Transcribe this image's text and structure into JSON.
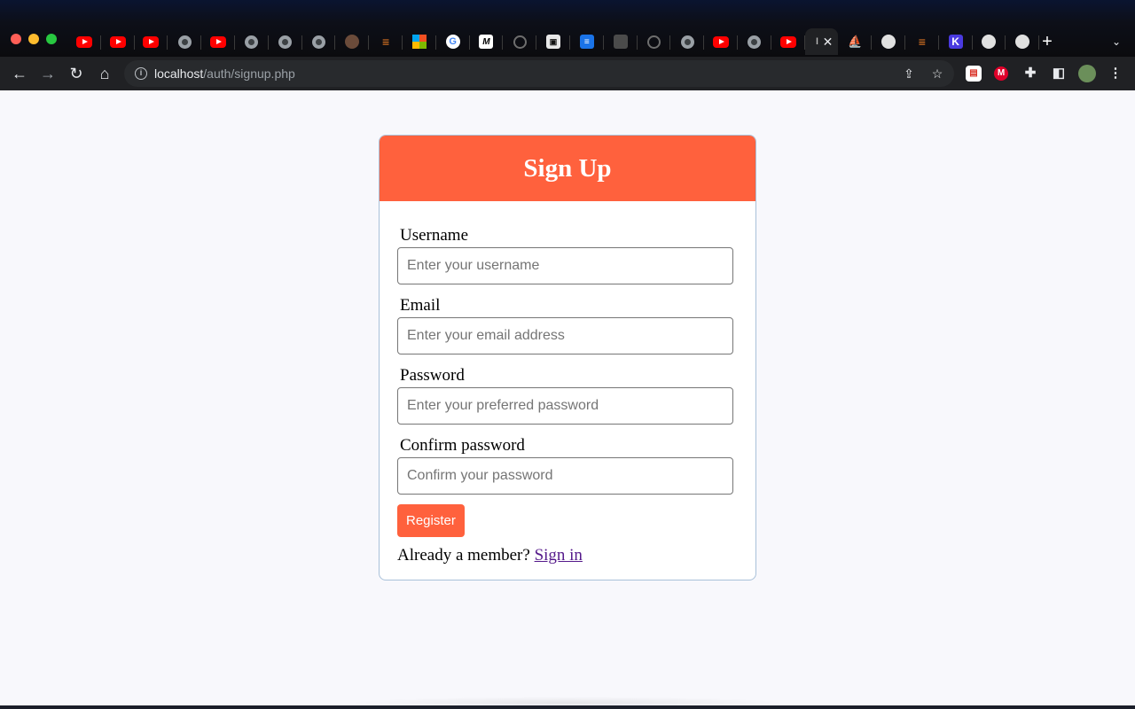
{
  "browser": {
    "tabs": [
      {
        "icon": "youtube-icon",
        "glyph": ""
      },
      {
        "icon": "youtube-icon",
        "glyph": ""
      },
      {
        "icon": "youtube-icon",
        "glyph": ""
      },
      {
        "icon": "globe-icon",
        "glyph": ""
      },
      {
        "icon": "youtube-icon",
        "glyph": ""
      },
      {
        "icon": "globe-icon",
        "glyph": ""
      },
      {
        "icon": "globe-icon",
        "glyph": ""
      },
      {
        "icon": "globe-icon",
        "glyph": ""
      },
      {
        "icon": "mascot-icon",
        "glyph": ""
      },
      {
        "icon": "stackoverflow-icon",
        "glyph": "≡"
      },
      {
        "icon": "microsoft-icon",
        "glyph": ""
      },
      {
        "icon": "google-icon",
        "glyph": "G"
      },
      {
        "icon": "medium-icon",
        "glyph": "M"
      },
      {
        "icon": "github-icon",
        "glyph": ""
      },
      {
        "icon": "terminal-icon",
        "glyph": "▣"
      },
      {
        "icon": "document-icon",
        "glyph": "≡"
      },
      {
        "icon": "image-icon",
        "glyph": ""
      },
      {
        "icon": "github-icon",
        "glyph": ""
      },
      {
        "icon": "globe-icon",
        "glyph": ""
      },
      {
        "icon": "youtube-icon",
        "glyph": ""
      },
      {
        "icon": "globe-icon",
        "glyph": ""
      },
      {
        "icon": "youtube-icon",
        "glyph": ""
      },
      {
        "icon": "partial-icon",
        "glyph": "l"
      },
      {
        "icon": "sailboat-icon",
        "glyph": "⛵"
      },
      {
        "icon": "elephant-icon",
        "glyph": ""
      },
      {
        "icon": "stackoverflow-icon",
        "glyph": "≡"
      },
      {
        "icon": "k-icon",
        "glyph": "K"
      },
      {
        "icon": "elephant-icon",
        "glyph": ""
      },
      {
        "icon": "elephant-icon",
        "glyph": ""
      }
    ],
    "active_tab_index": 22,
    "close_glyph": "✕",
    "new_tab_glyph": "+",
    "tab_search_glyph": "⌄",
    "nav": {
      "back": "←",
      "forward": "→",
      "reload": "↻",
      "home": "⌂"
    },
    "url_host": "localhost",
    "url_path": "/auth/signup.php",
    "info_glyph": "i",
    "share_glyph": "⇪",
    "bookmark_glyph": "☆",
    "extensions": [
      {
        "name": "extension-pdf-icon",
        "glyph": "▤",
        "color": "#ffffff",
        "text_color": "#d93025"
      },
      {
        "name": "extension-m-icon",
        "glyph": "M",
        "color": "#e0002a",
        "text_color": "#ffffff"
      },
      {
        "name": "extensions-puzzle-icon",
        "glyph": "✚",
        "color": "transparent",
        "text_color": "#e8eaed"
      },
      {
        "name": "side-panel-icon",
        "glyph": "◧",
        "color": "transparent",
        "text_color": "#e8eaed"
      },
      {
        "name": "profile-avatar",
        "glyph": "",
        "color": "#6b8f5a",
        "text_color": "#ffffff"
      },
      {
        "name": "menu-kebab-icon",
        "glyph": "⋮",
        "color": "transparent",
        "text_color": "#e8eaed"
      }
    ]
  },
  "page": {
    "title": "Sign Up",
    "fields": [
      {
        "label": "Username",
        "placeholder": "Enter your username",
        "value": "",
        "type": "text"
      },
      {
        "label": "Email",
        "placeholder": "Enter your email address",
        "value": "",
        "type": "email"
      },
      {
        "label": "Password",
        "placeholder": "Enter your preferred password",
        "value": "",
        "type": "password"
      },
      {
        "label": "Confirm password",
        "placeholder": "Confirm your password",
        "value": "",
        "type": "password"
      }
    ],
    "register_label": "Register",
    "member_prompt": "Already a member?",
    "signin_label": "Sign in"
  },
  "colors": {
    "accent": "#ff613d",
    "card_border": "#a9c1d9",
    "page_bg": "#f8f8fc",
    "link_visited": "#551a8b"
  }
}
